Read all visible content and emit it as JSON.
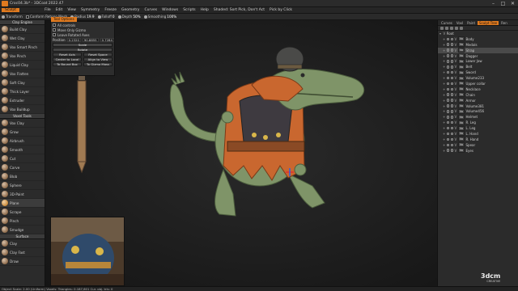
{
  "window": {
    "title": "Croc04.3b* - 3DCoat 2022.47",
    "controls": [
      "–",
      "□",
      "✕"
    ]
  },
  "menu": {
    "items": [
      "Sculpt",
      "File",
      "Edit",
      "View",
      "Symmetry",
      "Freeze",
      "Geometry",
      "Curves",
      "Windows",
      "Scripts",
      "Help",
      "Shaded: Sort Pick, Don't Act",
      "Pick by Click"
    ]
  },
  "toolbar": {
    "transform": "Transform",
    "conform_retopo": "Conform Retopo Mesh",
    "radius_label": "Radius",
    "radius_value": "19.9",
    "falloff_label": "Falloff",
    "falloff_value": "0",
    "depth_label": "Depth",
    "depth_value": "50%",
    "smoothing_label": "Smoothing",
    "smoothing_value": "100%"
  },
  "left_panel": {
    "sections": [
      {
        "header": "Clay Engine",
        "tools": [
          "Build Clay",
          "Wet Clay",
          "Vox Smart Pinch",
          "Vox Pinch",
          "Liquid Clay",
          "Vox Flatten",
          "Soft Clay",
          "Thick Layer",
          "Extruder",
          "Vox Buildup"
        ]
      },
      {
        "header": "Voxel Tools",
        "tools": [
          "Vox Clay",
          "Grow",
          "Airbrush",
          "Smooth",
          "Cut",
          "Carve",
          "Blob",
          "Sphere",
          "3D-Paint",
          "Plane",
          "Scrape",
          "Pinch",
          "Smudge"
        ]
      },
      {
        "header": "Surface",
        "tools": [
          "Clay",
          "Clay Fast",
          "Draw"
        ]
      }
    ],
    "active_tool": "Plane"
  },
  "tool_options": {
    "title": "Tool Options",
    "all_controls": "All controls",
    "move_only_gizmo": "Move Only Gizmo",
    "leave_rotated_axes": "Leave Rotated Axes",
    "position_label": "Position",
    "position_values": [
      "0.2320",
      "90.8855",
      "0.7284"
    ],
    "scale_label": "Scale",
    "rotate_label": "Rotate",
    "reset_axis": "Reset Axis",
    "reset_space": "Reset Space",
    "center_to_local": "Center to Local",
    "align_to_view": "Align to View",
    "to_bound_box": "To Bound Box",
    "to_gizmo_mass": "To Gizmo Mass"
  },
  "right_panel": {
    "tabs": [
      "Curves",
      "Voxl",
      "Paint",
      "Sculpt Tree",
      "Ren"
    ],
    "active_tab": "Sculpt Tree",
    "root_label": "Root",
    "items": [
      {
        "name": "Body",
        "tag": "Vo"
      },
      {
        "name": "Medals",
        "tag": "Vo"
      },
      {
        "name": "Strap",
        "tag": "Vo",
        "selected": true
      },
      {
        "name": "Dagger",
        "tag": "Vo"
      },
      {
        "name": "Lower Jaw",
        "tag": "Vo"
      },
      {
        "name": "Belt",
        "tag": "Vo"
      },
      {
        "name": "Sword",
        "tag": "Vo"
      },
      {
        "name": "Volume233",
        "tag": "Vo"
      },
      {
        "name": "Upper collar",
        "tag": "Vo"
      },
      {
        "name": "Necklace",
        "tag": "Vo"
      },
      {
        "name": "Chain",
        "tag": "Vo"
      },
      {
        "name": "Armor",
        "tag": "Vo"
      },
      {
        "name": "Volume381",
        "tag": "Vo"
      },
      {
        "name": "Volume456",
        "tag": "Vo"
      },
      {
        "name": "Helmet",
        "tag": "Vo"
      },
      {
        "name": "R. Leg",
        "tag": "Vo"
      },
      {
        "name": "L. Leg",
        "tag": "Vo"
      },
      {
        "name": "L. Hand",
        "tag": "Vo"
      },
      {
        "name": "R. Hand",
        "tag": "Vo"
      },
      {
        "name": "Spear",
        "tag": "Vo"
      },
      {
        "name": "Eyes",
        "tag": "Vo"
      }
    ]
  },
  "statusbar": {
    "text": "Object Scale: 2.00 (Uniform) Voxels: Triangles: 0.187,601 Cur. obj. tris: 0"
  },
  "watermark": {
    "brand": "3dcm",
    "sub": "CREATIVE"
  },
  "colors": {
    "accent": "#e07a1f",
    "croc_skin": "#7f9468",
    "armor_orange": "#c9672f",
    "helmet": "#4a4a48"
  }
}
